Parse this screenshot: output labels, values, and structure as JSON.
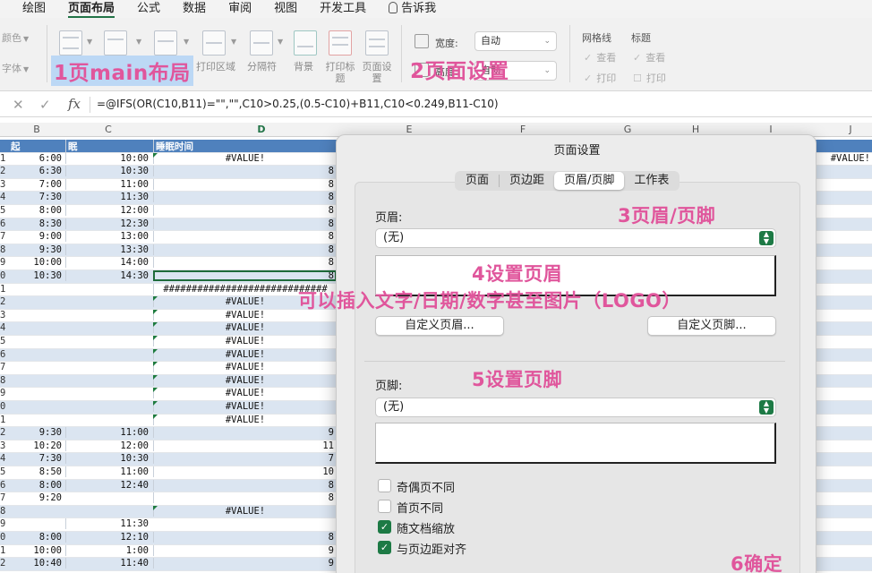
{
  "ribbon_tabs": [
    "绘图",
    "页面布局",
    "公式",
    "数据",
    "审阅",
    "视图",
    "开发工具",
    "告诉我"
  ],
  "ribbon_left": [
    "颜色",
    "字体"
  ],
  "ribbon_buttons": {
    "print_area": "打印区域",
    "breaks": "分隔符",
    "background": "背景",
    "print_titles": "打印标题",
    "page_setup": "页面设置"
  },
  "page_setup_group": {
    "width_label": "宽度:",
    "width_value": "自动",
    "height_label": "高度:",
    "height_value": "自动"
  },
  "sheet_options": {
    "gridlines": "网格线",
    "headings": "标题",
    "view": "查看",
    "print": "打印"
  },
  "annotations": {
    "a1": "1页main布局",
    "a2": "2页面设置",
    "a3": "3页眉/页脚",
    "a4": "4设置页眉",
    "a4_sub": "可以插入文字/日期/数字甚至图片（LOGO）",
    "a5": "5设置页脚",
    "a6": "6确定"
  },
  "formula_bar": {
    "fx": "fx",
    "formula": "=@IFS(OR(C10,B11)=\"\",\"\",C10>0.25,(0.5-C10)+B11,C10<0.249,B11-C10)"
  },
  "columns": [
    "B",
    "C",
    "D",
    "E",
    "F",
    "G",
    "H",
    "I",
    "J"
  ],
  "sheet": {
    "headers": {
      "b": "起",
      "c": "眠",
      "d": "睡眠时间"
    },
    "j_value": "#VALUE!",
    "rows": [
      {
        "n": "1",
        "b": "6:00",
        "c": "10:00",
        "d": "#VALUE!"
      },
      {
        "n": "2",
        "b": "6:30",
        "c": "10:30",
        "d": "8"
      },
      {
        "n": "3",
        "b": "7:00",
        "c": "11:00",
        "d": "8"
      },
      {
        "n": "4",
        "b": "7:30",
        "c": "11:30",
        "d": "8"
      },
      {
        "n": "5",
        "b": "8:00",
        "c": "12:00",
        "d": "8"
      },
      {
        "n": "6",
        "b": "8:30",
        "c": "12:30",
        "d": "8"
      },
      {
        "n": "7",
        "b": "9:00",
        "c": "13:00",
        "d": "8"
      },
      {
        "n": "8",
        "b": "9:30",
        "c": "13:30",
        "d": "8"
      },
      {
        "n": "9",
        "b": "10:00",
        "c": "14:00",
        "d": "8"
      },
      {
        "n": "0",
        "b": "10:30",
        "c": "14:30",
        "d": "8"
      },
      {
        "n": "1",
        "b": "",
        "c": "",
        "d": "#############################"
      },
      {
        "n": "2",
        "b": "",
        "c": "",
        "d": "#VALUE!"
      },
      {
        "n": "3",
        "b": "",
        "c": "",
        "d": "#VALUE!"
      },
      {
        "n": "4",
        "b": "",
        "c": "",
        "d": "#VALUE!"
      },
      {
        "n": "5",
        "b": "",
        "c": "",
        "d": "#VALUE!"
      },
      {
        "n": "6",
        "b": "",
        "c": "",
        "d": "#VALUE!"
      },
      {
        "n": "7",
        "b": "",
        "c": "",
        "d": "#VALUE!"
      },
      {
        "n": "8",
        "b": "",
        "c": "",
        "d": "#VALUE!"
      },
      {
        "n": "9",
        "b": "",
        "c": "",
        "d": "#VALUE!"
      },
      {
        "n": "0",
        "b": "",
        "c": "",
        "d": "#VALUE!"
      },
      {
        "n": "1",
        "b": "",
        "c": "",
        "d": "#VALUE!"
      },
      {
        "n": "2",
        "b": "9:30",
        "c": "11:00",
        "d": "9"
      },
      {
        "n": "3",
        "b": "10:20",
        "c": "12:00",
        "d": "11"
      },
      {
        "n": "4",
        "b": "7:30",
        "c": "10:30",
        "d": "7"
      },
      {
        "n": "5",
        "b": "8:50",
        "c": "11:00",
        "d": "10"
      },
      {
        "n": "6",
        "b": "8:00",
        "c": "12:40",
        "d": "8"
      },
      {
        "n": "7",
        "b": "9:20",
        "c": "",
        "d": "8"
      },
      {
        "n": "8",
        "b": "",
        "c": "",
        "d": "#VALUE!"
      },
      {
        "n": "9",
        "b": "",
        "c": "11:30",
        "d": ""
      },
      {
        "n": "0",
        "b": "8:00",
        "c": "12:10",
        "d": "8"
      },
      {
        "n": "1",
        "b": "10:00",
        "c": "1:00",
        "d": "9"
      },
      {
        "n": "2",
        "b": "10:40",
        "c": "11:40",
        "d": "9"
      }
    ]
  },
  "dialog": {
    "title": "页面设置",
    "tabs": [
      "页面",
      "页边距",
      "页眉/页脚",
      "工作表"
    ],
    "header_label": "页眉:",
    "header_value": "(无)",
    "custom_header": "自定义页眉...",
    "custom_footer": "自定义页脚...",
    "footer_label": "页脚:",
    "footer_value": "(无)",
    "options": [
      {
        "label": "奇偶页不同",
        "checked": false
      },
      {
        "label": "首页不同",
        "checked": false
      },
      {
        "label": "随文档缩放",
        "checked": true
      },
      {
        "label": "与页边距对齐",
        "checked": true
      }
    ]
  },
  "colors": {
    "accent_green": "#1d7a45",
    "annotation_pink": "#e0569c",
    "table_header_blue": "#4f81bd",
    "alt_row_blue": "#dbe5f1"
  }
}
